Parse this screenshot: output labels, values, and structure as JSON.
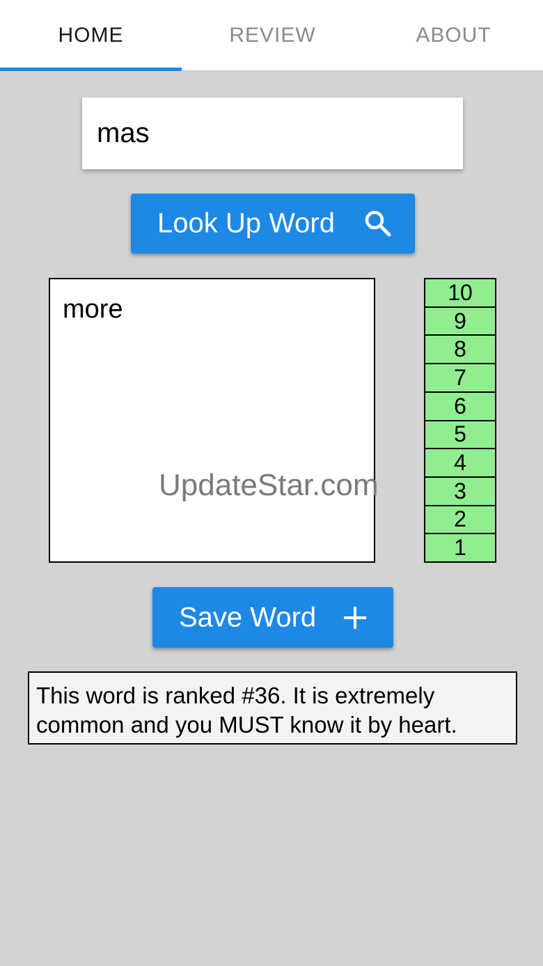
{
  "tabs": [
    {
      "label": "HOME",
      "active": true
    },
    {
      "label": "REVIEW",
      "active": false
    },
    {
      "label": "ABOUT",
      "active": false
    }
  ],
  "search": {
    "value": "mas"
  },
  "lookup_button": {
    "label": "Look Up Word",
    "icon": "search-icon"
  },
  "definition": {
    "text": "more"
  },
  "ranks": [
    "10",
    "9",
    "8",
    "7",
    "6",
    "5",
    "4",
    "3",
    "2",
    "1"
  ],
  "save_button": {
    "label": "Save Word",
    "icon": "plus-icon"
  },
  "rank_message": "This word is ranked #36. It is extremely common and you MUST know it by heart.",
  "watermark": "UpdateStar.com",
  "colors": {
    "accent": "#1e88e5",
    "rank_fill": "#90ee90",
    "background": "#d3d3d3"
  }
}
